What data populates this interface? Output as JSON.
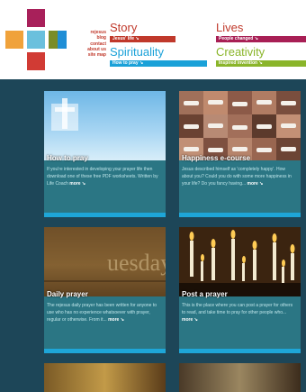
{
  "colors": {
    "background": "#1d4658",
    "story": "#c0392b",
    "lives": "#c0392b",
    "spirituality": "#1aa1d8",
    "creativity": "#8ab52a",
    "card_text": "#2b7684",
    "card_strip": "#1ea6d8"
  },
  "logo": {
    "squares": [
      "#a8205a",
      "#6ac0dd",
      "#f0a23b",
      "#1f8ed6",
      "#7a8c28",
      "#d13b34"
    ]
  },
  "sidelinks": [
    "rejesus",
    "blog",
    "contact",
    "about us",
    "site map"
  ],
  "nav": {
    "story": {
      "title": "Story",
      "sub": "Jesus' life ↘"
    },
    "lives": {
      "title": "Lives",
      "sub": "People changed ↘"
    },
    "spirituality": {
      "title": "Spirituality",
      "sub": "How to pray ↘"
    },
    "creativity": {
      "title": "Creativity",
      "sub": "Inspired invention ↘"
    }
  },
  "cards": [
    {
      "title": "How to pray",
      "body": "If you're interested in developing your prayer life then download one of these free PDF worksheets. Written by Life Coach",
      "more": "more ↘",
      "image": "blue-sky-cross"
    },
    {
      "title": "Happiness e-course",
      "body": "Jesus described himself as 'completely happy'. How about you? Could you do with some more happiness in your life? Do you fancy having...",
      "more": "more ↘",
      "image": "smiling-mouths-grid"
    },
    {
      "title": "Daily prayer",
      "body": "The rejesus daily prayer has been written for anyone to use who has no experience whatsoever with prayer, regular or otherwise. From it...",
      "more": "more ↘",
      "image": "tuesday-calendar"
    },
    {
      "title": "Post a prayer",
      "body": "This is the place where you can post a prayer for others to read, and take time to pray for other people who...",
      "more": "more ↘",
      "image": "candles"
    },
    {
      "title": "",
      "body": "",
      "more": "",
      "image": "painting-fragment"
    },
    {
      "title": "",
      "body": "",
      "more": "",
      "image": "crowd-fragment"
    }
  ]
}
